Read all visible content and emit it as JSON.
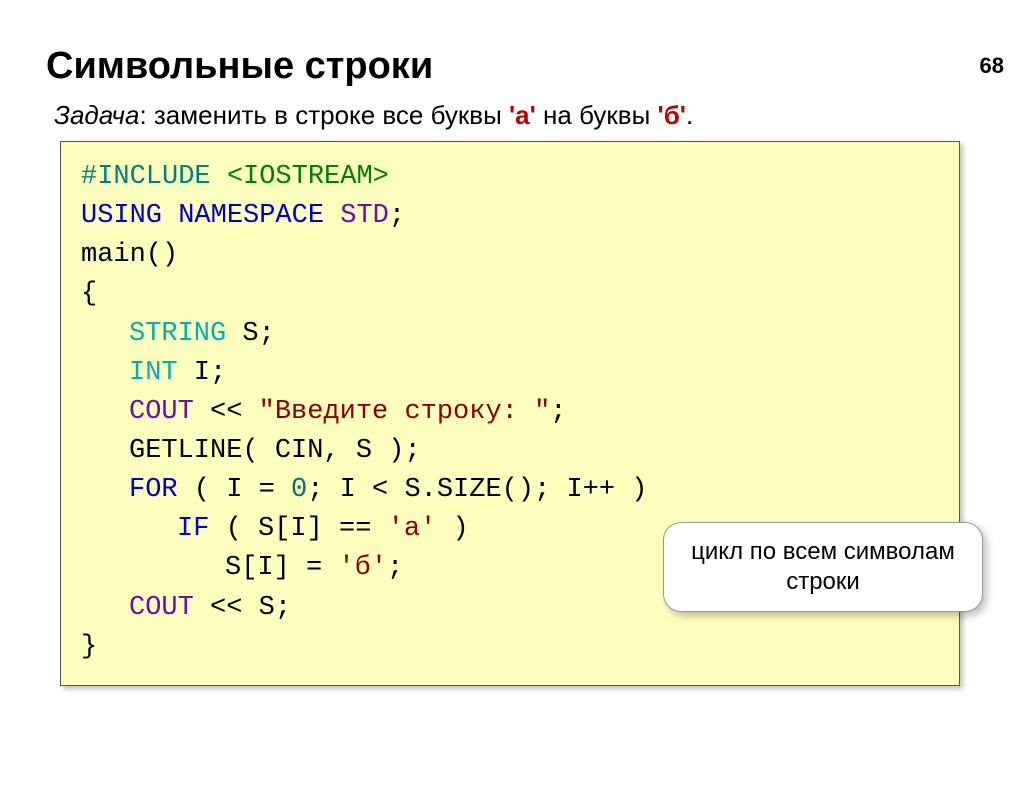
{
  "page_number": "68",
  "heading": "Символьные строки",
  "task": {
    "label": "Задача",
    "text": ": заменить в строке все буквы ",
    "ch1": "'а'",
    "mid": " на буквы ",
    "ch2": "'б'",
    "end": "."
  },
  "code": {
    "l1_hash": "#",
    "l1_include": "INCLUDE",
    "l1_io": " <IOSTREAM>",
    "l2_using": "USING ",
    "l2_ns": "NAMESPACE ",
    "l2_std": "STD",
    "l2_semi": ";",
    "l3": "main()",
    "l4": "{",
    "l5_string": "STRING",
    "l5_s": " S;",
    "l6_int": "INT",
    "l6_i": " I;",
    "l7_cout": "COUT",
    "l7_mid": " << ",
    "l7_str": "\"Введите строку: \"",
    "l7_semi": ";",
    "l8": "GETLINE( CIN, S );",
    "l9_for": "FOR",
    "l9_open": " ( I = ",
    "l9_zero": "0",
    "l9_mid": "; I < S.",
    "l9_size": "SIZE",
    "l9_close": "(); I++ )",
    "l10_if": "IF",
    "l10_open": " ( S[I] == ",
    "l10_ch": "'а'",
    "l10_close": " )",
    "l11_lhs": "S[I] = ",
    "l11_ch": "'б'",
    "l11_semi": ";",
    "l12_cout": "COUT",
    "l12_rest": " << S;",
    "l13": "}"
  },
  "callout": "цикл по всем символам строки"
}
